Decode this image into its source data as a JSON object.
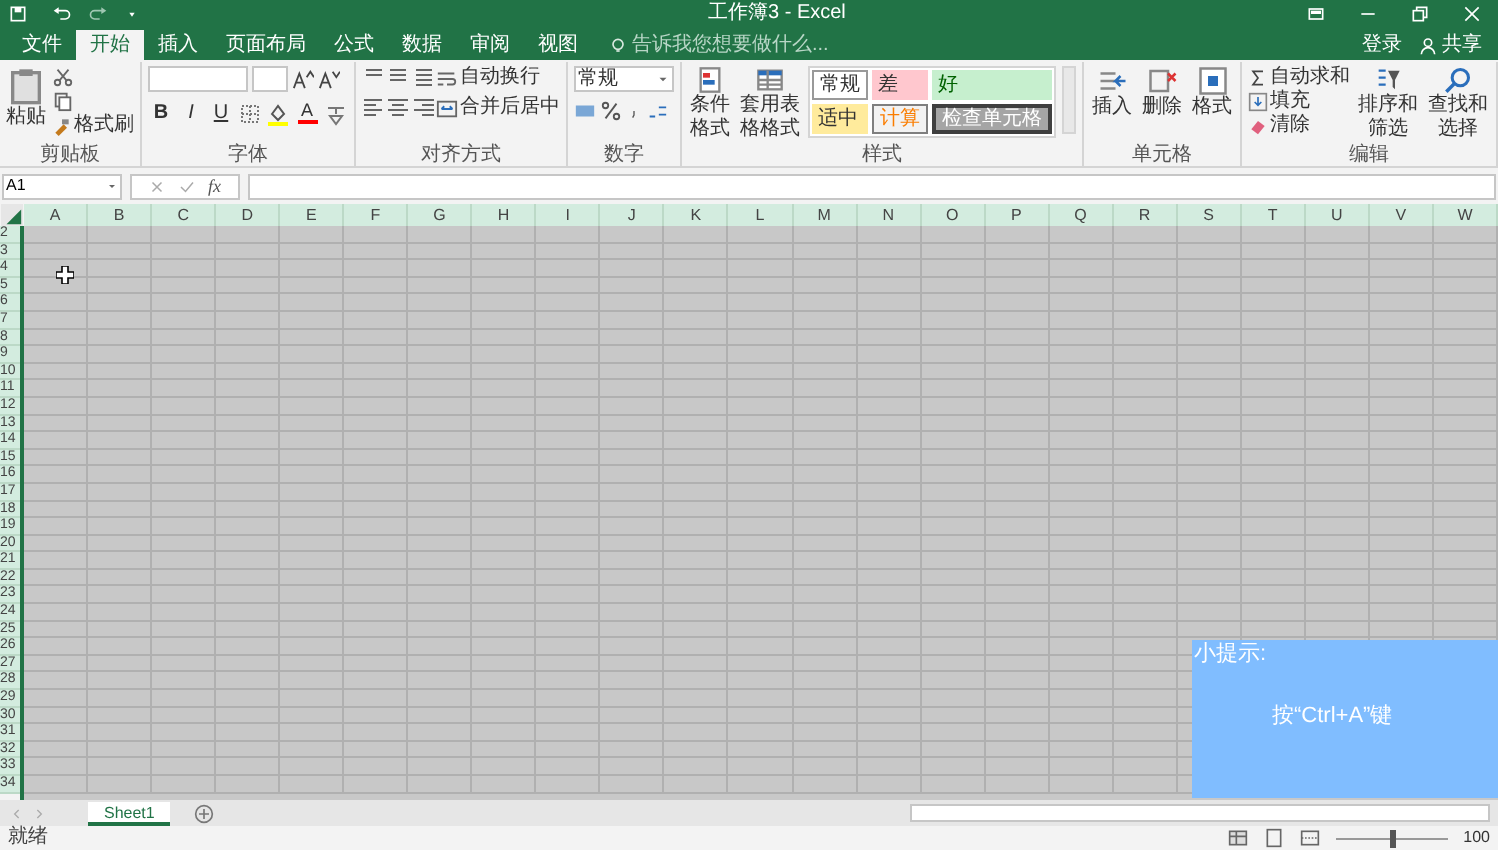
{
  "window": {
    "title": "工作簿3 - Excel"
  },
  "ribbon_tabs": [
    {
      "label": "文件",
      "selected": false
    },
    {
      "label": "开始",
      "selected": true
    },
    {
      "label": "插入",
      "selected": false
    },
    {
      "label": "页面布局",
      "selected": false
    },
    {
      "label": "公式",
      "selected": false
    },
    {
      "label": "数据",
      "selected": false
    },
    {
      "label": "审阅",
      "selected": false
    },
    {
      "label": "视图",
      "selected": false
    }
  ],
  "tell_me": {
    "placeholder": "告诉我您想要做什么..."
  },
  "account": {
    "sign_in": "登录",
    "share": "共享"
  },
  "clipboard": {
    "paste": "粘贴",
    "format_painter": "格式刷",
    "label": "剪贴板"
  },
  "font": {
    "bold": "B",
    "italic": "I",
    "underline": "U",
    "font_color": "A",
    "label": "字体"
  },
  "alignment": {
    "wrap_text": "自动换行",
    "merge_center": "合并后居中",
    "label": "对齐方式"
  },
  "number": {
    "format": "常规",
    "label": "数字"
  },
  "styles": {
    "conditional_formatting": "条件格式",
    "format_as_table": "套用表格格式",
    "label": "样式",
    "cell_styles": [
      {
        "label": "常规",
        "kind": "normal",
        "color": "#ffffff"
      },
      {
        "label": "差",
        "kind": "bad",
        "color": "#ffc7ce"
      },
      {
        "label": "好",
        "kind": "good",
        "color": "#c6efce"
      },
      {
        "label": "适中",
        "kind": "neutral",
        "color": "#ffeb9c"
      },
      {
        "label": "计算",
        "kind": "calculation",
        "color": "#f2f2f2"
      },
      {
        "label": "检查单元格",
        "kind": "check",
        "color": "#a5a5a5"
      }
    ]
  },
  "cells": {
    "buttons": [
      "插入",
      "删除",
      "格式"
    ],
    "label": "单元格"
  },
  "editing": {
    "autosum": "自动求和",
    "fill": "填充",
    "clear": "清除",
    "sort_filter": "排序和筛选",
    "find_select": "查找和选择",
    "label": "编辑"
  },
  "formula_bar": {
    "name_box": "A1",
    "function_label": "fx"
  },
  "sheet": {
    "all_selected": true,
    "columns": [
      "A",
      "B",
      "C",
      "D",
      "E",
      "F",
      "G",
      "H",
      "I",
      "J",
      "K",
      "L",
      "M",
      "N",
      "O",
      "P",
      "Q",
      "R",
      "S",
      "T",
      "U",
      "V",
      "W"
    ],
    "rows": [
      "2",
      "3",
      "4",
      "5",
      "6",
      "7",
      "8",
      "9",
      "10",
      "11",
      "12",
      "13",
      "14",
      "15",
      "16",
      "17",
      "18",
      "19",
      "20",
      "21",
      "22",
      "23",
      "24",
      "25",
      "26",
      "27",
      "28",
      "29",
      "30",
      "31",
      "32",
      "33",
      "34"
    ]
  },
  "sheet_tabs": [
    {
      "label": "Sheet1",
      "selected": true
    }
  ],
  "status_bar": {
    "status": "就绪",
    "zoom": "100",
    "zoom_slider": {
      "level": 0.5
    }
  },
  "tip": {
    "title": "小提示:",
    "body": "按“Ctrl+A”键"
  }
}
